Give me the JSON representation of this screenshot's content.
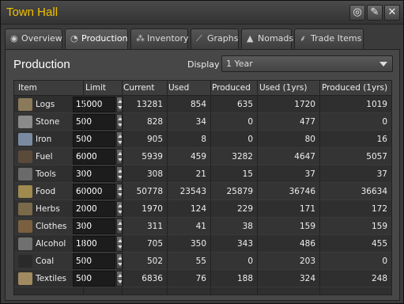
{
  "window": {
    "title": "Town Hall"
  },
  "tabs": [
    {
      "label": "Overview",
      "icon": "eye-icon"
    },
    {
      "label": "Production",
      "icon": "gauge-icon"
    },
    {
      "label": "Inventory",
      "icon": "boxes-icon"
    },
    {
      "label": "Graphs",
      "icon": "graph-icon"
    },
    {
      "label": "Nomads",
      "icon": "tent-icon"
    },
    {
      "label": "Trade Items",
      "icon": "wheat-icon"
    }
  ],
  "panel": {
    "title": "Production",
    "display_label": "Display",
    "display_value": "1 Year"
  },
  "table": {
    "headers": [
      "Item",
      "Limit",
      "Current",
      "Used",
      "Produced",
      "Used (1yrs)",
      "Produced (1yrs)"
    ],
    "rows": [
      {
        "item": "Logs",
        "icon": "logs-icon",
        "color": "#8a7a5a",
        "limit": "15000",
        "current": "13281",
        "used": "854",
        "produced": "635",
        "used1": "1720",
        "produced1": "1019"
      },
      {
        "item": "Stone",
        "icon": "stone-icon",
        "color": "#8a8a8a",
        "limit": "500",
        "current": "828",
        "used": "34",
        "produced": "0",
        "used1": "477",
        "produced1": "0"
      },
      {
        "item": "Iron",
        "icon": "iron-icon",
        "color": "#7a8aa0",
        "limit": "500",
        "current": "905",
        "used": "8",
        "produced": "0",
        "used1": "80",
        "produced1": "16"
      },
      {
        "item": "Fuel",
        "icon": "fuel-icon",
        "color": "#5a4a3a",
        "limit": "6000",
        "current": "5939",
        "used": "459",
        "produced": "3282",
        "used1": "4647",
        "produced1": "5057"
      },
      {
        "item": "Tools",
        "icon": "tools-icon",
        "color": "#6a6a6a",
        "limit": "300",
        "current": "308",
        "used": "21",
        "produced": "15",
        "used1": "37",
        "produced1": "37"
      },
      {
        "item": "Food",
        "icon": "food-icon",
        "color": "#a08a50",
        "limit": "60000",
        "current": "50778",
        "used": "23543",
        "produced": "25879",
        "used1": "36746",
        "produced1": "36634"
      },
      {
        "item": "Herbs",
        "icon": "herbs-icon",
        "color": "#7a6a4a",
        "limit": "2000",
        "current": "1970",
        "used": "124",
        "produced": "229",
        "used1": "171",
        "produced1": "172"
      },
      {
        "item": "Clothes",
        "icon": "clothes-icon",
        "color": "#7a6040",
        "limit": "300",
        "current": "311",
        "used": "41",
        "produced": "38",
        "used1": "159",
        "produced1": "159"
      },
      {
        "item": "Alcohol",
        "icon": "alcohol-icon",
        "color": "#707070",
        "limit": "1800",
        "current": "705",
        "used": "350",
        "produced": "343",
        "used1": "486",
        "produced1": "455"
      },
      {
        "item": "Coal",
        "icon": "coal-icon",
        "color": "#2a2a2a",
        "limit": "500",
        "current": "502",
        "used": "55",
        "produced": "0",
        "used1": "203",
        "produced1": "0"
      },
      {
        "item": "Textiles",
        "icon": "textiles-icon",
        "color": "#a08a60",
        "limit": "500",
        "current": "6836",
        "used": "76",
        "produced": "188",
        "used1": "324",
        "produced1": "248"
      }
    ]
  }
}
